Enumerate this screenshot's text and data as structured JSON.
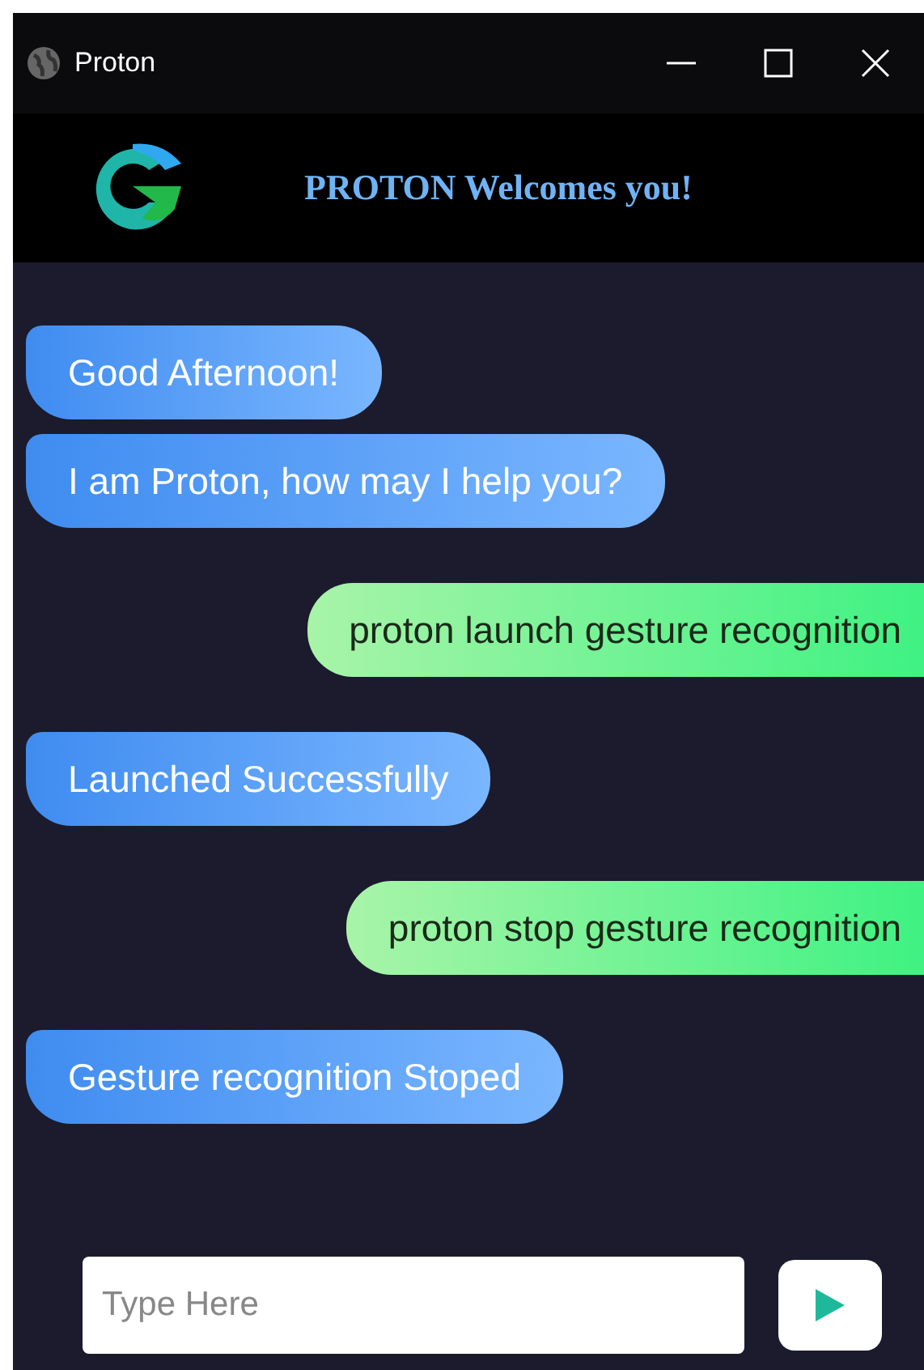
{
  "window": {
    "title": "Proton"
  },
  "header": {
    "title": "PROTON Welcomes you!"
  },
  "messages": [
    {
      "kind": "bot",
      "text": "Good Afternoon!"
    },
    {
      "kind": "bot",
      "text": "I am Proton, how may I help you?"
    },
    {
      "kind": "user",
      "text": "proton launch gesture recognition"
    },
    {
      "kind": "bot",
      "text": "Launched Successfully"
    },
    {
      "kind": "user",
      "text": "proton stop gesture recognition"
    },
    {
      "kind": "bot",
      "text": "Gesture recognition Stoped"
    }
  ],
  "input": {
    "placeholder": "Type Here"
  }
}
